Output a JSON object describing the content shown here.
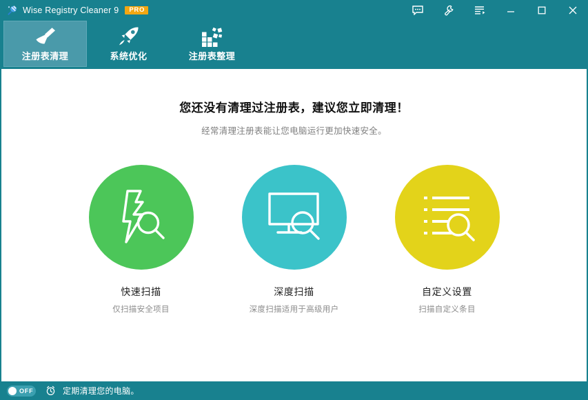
{
  "titlebar": {
    "app_icon": "wise-registry-cleaner-icon",
    "title": "Wise Registry Cleaner 9",
    "pro_badge": "PRO",
    "controls": [
      {
        "name": "feedback-icon",
        "label": ""
      },
      {
        "name": "wrench-icon",
        "label": ""
      },
      {
        "name": "menu-list-icon",
        "label": ""
      },
      {
        "name": "minimize-icon",
        "label": ""
      },
      {
        "name": "maximize-icon",
        "label": ""
      },
      {
        "name": "close-icon",
        "label": ""
      }
    ]
  },
  "tabs": [
    {
      "label": "注册表清理",
      "icon": "broom-icon",
      "active": true
    },
    {
      "label": "系统优化",
      "icon": "rocket-icon",
      "active": false
    },
    {
      "label": "注册表整理",
      "icon": "defrag-icon",
      "active": false
    }
  ],
  "main": {
    "headline": "您还没有清理过注册表，建议您立即清理！",
    "subhead": "经常清理注册表能让您电脑运行更加快速安全。",
    "actions": [
      {
        "label": "快速扫描",
        "desc": "仅扫描安全项目",
        "color": "#4cc659",
        "icon": "lightning-search-icon"
      },
      {
        "label": "深度扫描",
        "desc": "深度扫描适用于高级用户",
        "color": "#3bc3c9",
        "icon": "monitor-search-icon"
      },
      {
        "label": "自定义设置",
        "desc": "扫描自定义条目",
        "color": "#e3d31a",
        "icon": "list-search-icon"
      }
    ]
  },
  "statusbar": {
    "toggle_state": "OFF",
    "clock_icon": "alarm-clock-icon",
    "text": "定期清理您的电脑。"
  },
  "theme": {
    "header_teal": "#18818f",
    "active_tab_teal": "#4a9aaa",
    "pro_orange": "#f3a712",
    "content_bg": "#ffffff"
  }
}
